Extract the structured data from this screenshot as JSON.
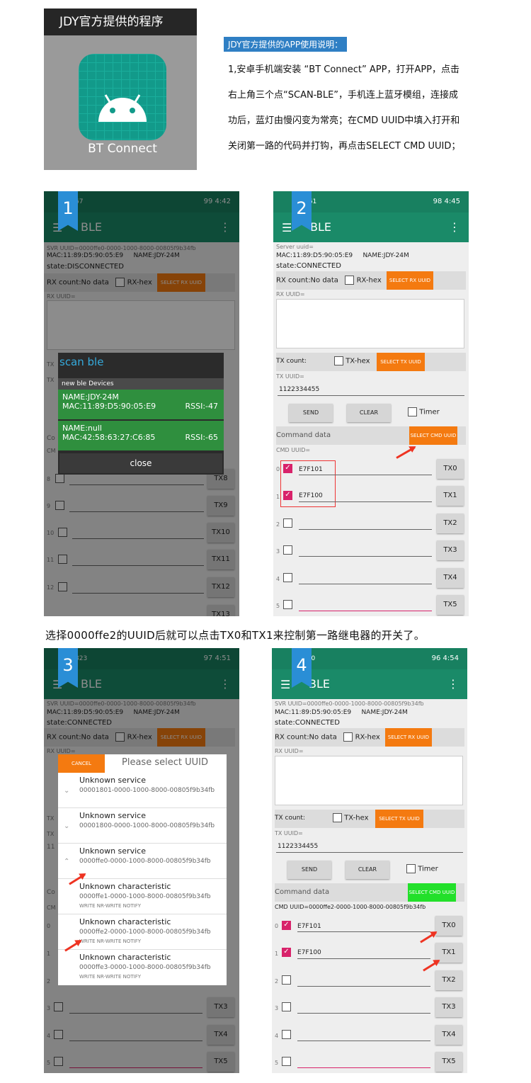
{
  "card": {
    "title": "JDY官方提供的程序",
    "app_name": "BT Connect"
  },
  "instructions": {
    "title": "JDY官方提供的APP使用说明：",
    "lines": [
      "1,安卓手机端安装 “BT Connect” APP，打开APP，点击",
      "右上角三个点“SCAN-BLE”，手机连上蓝牙模组，连接成",
      "功后，蓝灯由慢闪变为常亮；在CMD UUID中填入打开和",
      "关闭第一路的代码并打钩，再点击SELECT CMD UUID；"
    ]
  },
  "caption": "选择0000ffe2的UUID后就可以点击TX0和TX1来控制第一路继电器的开关了。",
  "common": {
    "app_title": "BLE",
    "mac": "MAC:11:89:D5:90:05:E9",
    "name": "NAME:JDY-24M",
    "rx_count": "RX count:No data",
    "rx_hex": "RX-hex",
    "select_rx": "SELECT RX UUID",
    "rx_uuid": "RX UUID=",
    "tx_count": "TX count:",
    "tx_hex": "TX-hex",
    "select_tx": "SELECT TX UUID",
    "tx_uuid": "TX UUID=",
    "tx_value": "1122334455",
    "send": "SEND",
    "clear": "CLEAR",
    "timer": "Timer",
    "command_data": "Command data",
    "select_cmd": "SELECT CMD UUID",
    "cmd_uuid": "CMD UUID=",
    "cmd1": "E7F101",
    "cmd0": "E7F100",
    "tx_labels": [
      "TX0",
      "TX1",
      "TX2",
      "TX3",
      "TX4",
      "TX5"
    ],
    "svr_uuid": "SVR UUID=0000ffe0-0000-1000-8000-00805f9b34fb",
    "state_conn": "state:CONNECTED",
    "state_disc": "state:DISCONNECTED"
  },
  "phones": {
    "p1": {
      "badge": "1",
      "status_left": "67",
      "status_right": "99 4:42",
      "tx_labels": [
        "TX8",
        "TX9",
        "TX10",
        "TX11",
        "TX12",
        "TX13"
      ],
      "row_nums": [
        "8",
        "9",
        "10",
        "11",
        "12"
      ],
      "dialog": {
        "title": "scan ble",
        "section": "new ble Devices",
        "devices": [
          {
            "name": "NAME:JDY-24M",
            "mac": "MAC:11:89:D5:90:05:E9",
            "rssi": "RSSI:-47"
          },
          {
            "name": "NAME:null",
            "mac": "MAC:42:58:63:27:C6:85",
            "rssi": "RSSI:-65"
          }
        ],
        "close": "close"
      }
    },
    "p2": {
      "badge": "2",
      "status_left": "761",
      "status_right": "98 4:45",
      "server_uuid": "Server uuid="
    },
    "p3": {
      "badge": "3",
      "status_left": "823",
      "status_right": "97 4:51",
      "dialog": {
        "cancel": "CANCEL",
        "title": "Please select UUID",
        "items": [
          {
            "t": "Unknown service",
            "u": "00001801-0000-1000-8000-00805f9b34fb",
            "p": ""
          },
          {
            "t": "Unknown service",
            "u": "00001800-0000-1000-8000-00805f9b34fb",
            "p": ""
          },
          {
            "t": "Unknown service",
            "u": "0000ffe0-0000-1000-8000-00805f9b34fb",
            "p": ""
          },
          {
            "t": "Unknown characteristic",
            "u": "0000ffe1-0000-1000-8000-00805f9b34fb",
            "p": "WRITE NR-WRITE NOTIFY"
          },
          {
            "t": "Unknown characteristic",
            "u": "0000ffe2-0000-1000-8000-00805f9b34fb",
            "p": "WRITE NR-WRITE NOTIFY"
          },
          {
            "t": "Unknown characteristic",
            "u": "0000ffe3-0000-1000-8000-00805f9b34fb",
            "p": "WRITE NR-WRITE NOTIFY"
          }
        ]
      }
    },
    "p4": {
      "badge": "4",
      "status_left": "150",
      "status_right": "96 4:54",
      "cmd_uuid_full": "CMD UUID=0000ffe2-0000-1000-8000-00805f9b34fb"
    }
  },
  "colors": {
    "accent_green": "#1a8a68",
    "orange": "#f47a10",
    "bright_green": "#22e02a",
    "pink": "#d8226a"
  }
}
